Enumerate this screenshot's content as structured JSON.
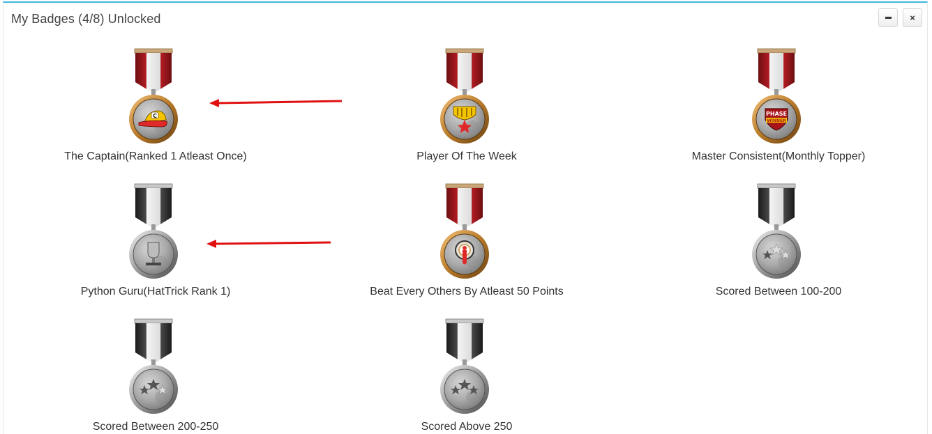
{
  "panel": {
    "title": "My Badges (4/8) Unlocked",
    "minimize_icon": "minus-icon",
    "close_label": "×"
  },
  "colors": {
    "panel_accent": "#3fb6de",
    "ribbon_unlocked": "#8b1a1a",
    "ribbon_locked": "#2b2b2b",
    "ring_unlocked": "#c8903a",
    "ring_locked": "#9a9a9a",
    "arrow": "#e01010"
  },
  "badges": [
    {
      "label": "The Captain(Ranked 1 Atleast Once)",
      "unlocked": true,
      "icon": "cap-icon"
    },
    {
      "label": "Player Of The Week",
      "unlocked": true,
      "icon": "shield-star-icon"
    },
    {
      "label": "Master Consistent(Monthly Topper)",
      "unlocked": true,
      "icon": "phase-winner-icon",
      "icon_text": [
        "PHASE",
        "WINNER"
      ]
    },
    {
      "label": "Python Guru(HatTrick Rank 1)",
      "unlocked": false,
      "icon": "trophy-icon"
    },
    {
      "label": "Beat Every Others By Atleast 50 Points",
      "unlocked": true,
      "icon": "target-icon"
    },
    {
      "label": "Scored Between 100-200",
      "unlocked": false,
      "icon": "stars-icon"
    },
    {
      "label": "Scored Between 200-250",
      "unlocked": false,
      "icon": "stars-icon"
    },
    {
      "label": "Scored Above 250",
      "unlocked": false,
      "icon": "stars-icon"
    }
  ],
  "annotations": [
    {
      "icon": "red-arrow-left-icon"
    },
    {
      "icon": "red-arrow-left-icon"
    }
  ]
}
